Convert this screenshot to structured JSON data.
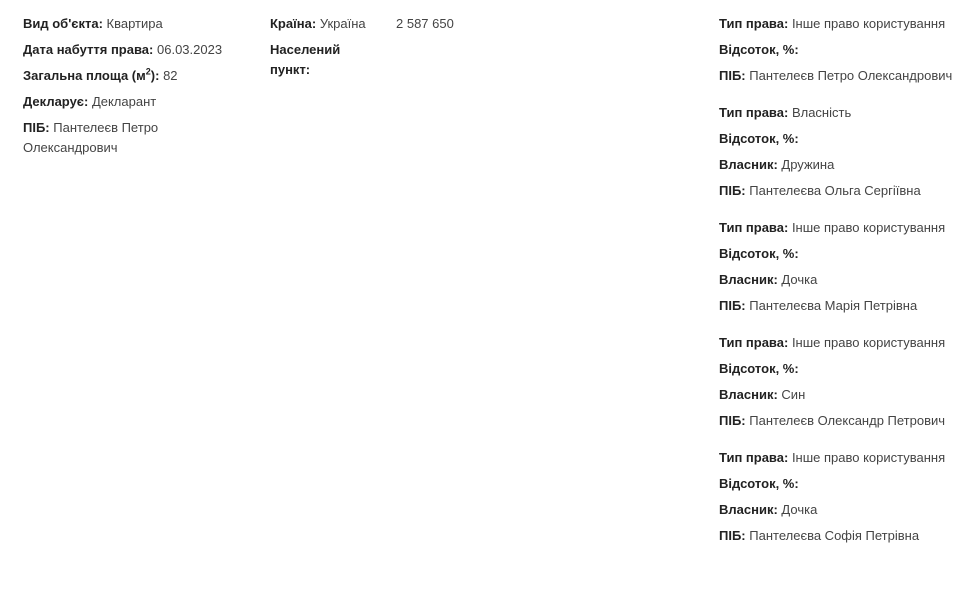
{
  "object": {
    "type_label": "Вид об'єкта:",
    "type_value": "Квартира",
    "acquired_label": "Дата набуття права:",
    "acquired_value": "06.03.2023",
    "area_label_prefix": "Загальна площа (м",
    "area_label_sup": "2",
    "area_label_suffix": "):",
    "area_value": "82",
    "declarant_label": "Декларує:",
    "declarant_value": "Декларант",
    "pib_label": "ПІБ:",
    "pib_value": "Пантелеєв Петро Олександрович"
  },
  "location": {
    "country_label": "Країна:",
    "country_value": "Україна",
    "settlement_label": "Населений пункт:",
    "settlement_value": ""
  },
  "value": {
    "amount": "2 587 650"
  },
  "rights": [
    {
      "right_type_label": "Тип права:",
      "right_type_value": "Інше право користування",
      "percent_label": "Відсоток, %:",
      "percent_value": "",
      "owner_label": "",
      "owner_value": "",
      "pib_label": "ПІБ:",
      "pib_value": "Пантелеєв Петро Олександрович"
    },
    {
      "right_type_label": "Тип права:",
      "right_type_value": "Власність",
      "percent_label": "Відсоток, %:",
      "percent_value": "",
      "owner_label": "Власник:",
      "owner_value": "Дружина",
      "pib_label": "ПІБ:",
      "pib_value": "Пантелеєва Ольга Сергіївна"
    },
    {
      "right_type_label": "Тип права:",
      "right_type_value": "Інше право користування",
      "percent_label": "Відсоток, %:",
      "percent_value": "",
      "owner_label": "Власник:",
      "owner_value": "Дочка",
      "pib_label": "ПІБ:",
      "pib_value": "Пантелеєва Марія Петрівна"
    },
    {
      "right_type_label": "Тип права:",
      "right_type_value": "Інше право користування",
      "percent_label": "Відсоток, %:",
      "percent_value": "",
      "owner_label": "Власник:",
      "owner_value": "Син",
      "pib_label": "ПІБ:",
      "pib_value": "Пантелеєв Олександр Петрович"
    },
    {
      "right_type_label": "Тип права:",
      "right_type_value": "Інше право користування",
      "percent_label": "Відсоток, %:",
      "percent_value": "",
      "owner_label": "Власник:",
      "owner_value": "Дочка",
      "pib_label": "ПІБ:",
      "pib_value": "Пантелеєва Софія Петрівна"
    }
  ]
}
